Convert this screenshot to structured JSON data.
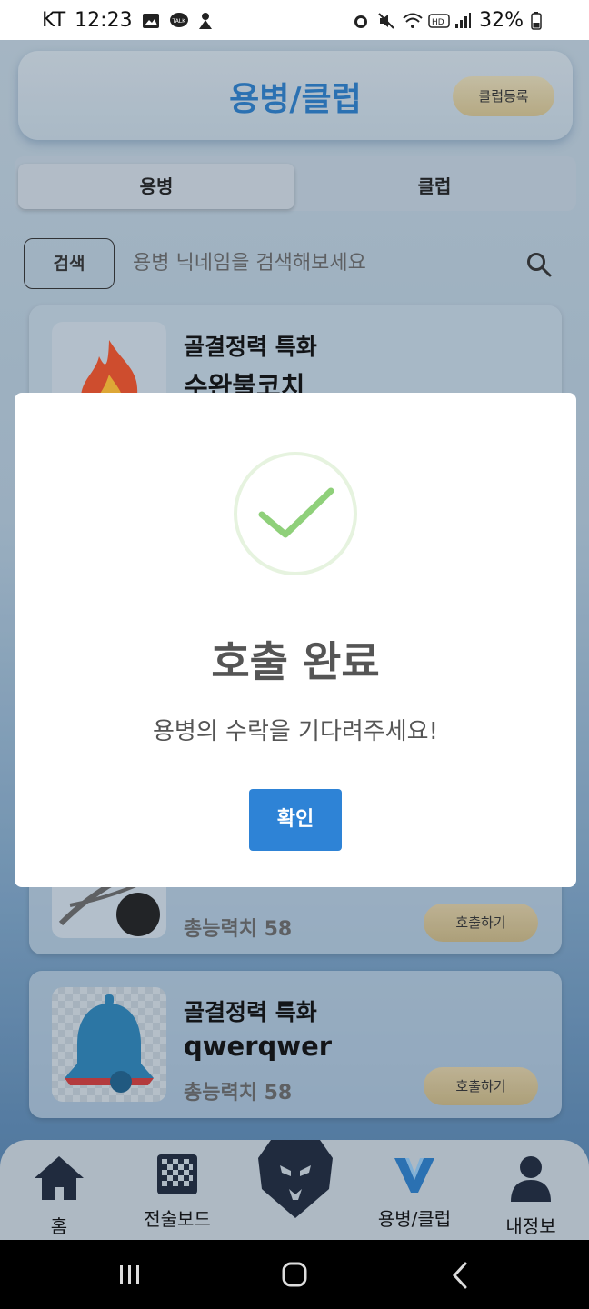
{
  "status_bar": {
    "carrier": "KT",
    "time": "12:23",
    "battery": "32%"
  },
  "header": {
    "title": "용병/클럽",
    "club_register": "클럽등록"
  },
  "tabs": [
    {
      "label": "용병",
      "active": true
    },
    {
      "label": "클럽",
      "active": false
    }
  ],
  "search": {
    "button": "검색",
    "placeholder": "용병 닉네임을 검색해보세요"
  },
  "cards": [
    {
      "specialty": "골결정력 특화",
      "nickname": "수완불코치",
      "score": "",
      "action": ""
    },
    {
      "specialty": "",
      "nickname": "",
      "score": "총능력치 58",
      "action": "호출하기"
    },
    {
      "specialty": "골결정력 특화",
      "nickname": "qwerqwer",
      "score": "총능력치 58",
      "action": "호출하기"
    }
  ],
  "bottom_nav": [
    {
      "label": "홈",
      "icon": "home-icon"
    },
    {
      "label": "전술보드",
      "icon": "checkerboard-icon"
    },
    {
      "label": "",
      "icon": "lion-logo-icon"
    },
    {
      "label": "용병/클럽",
      "icon": "v-logo-icon"
    },
    {
      "label": "내정보",
      "icon": "person-icon"
    }
  ],
  "modal": {
    "title": "호출 완료",
    "message": "용병의 수락을 기다려주세요!",
    "confirm": "확인"
  },
  "colors": {
    "accent": "#2e83d6",
    "title_blue": "#2c79c0",
    "check_green": "#8fd07a"
  }
}
